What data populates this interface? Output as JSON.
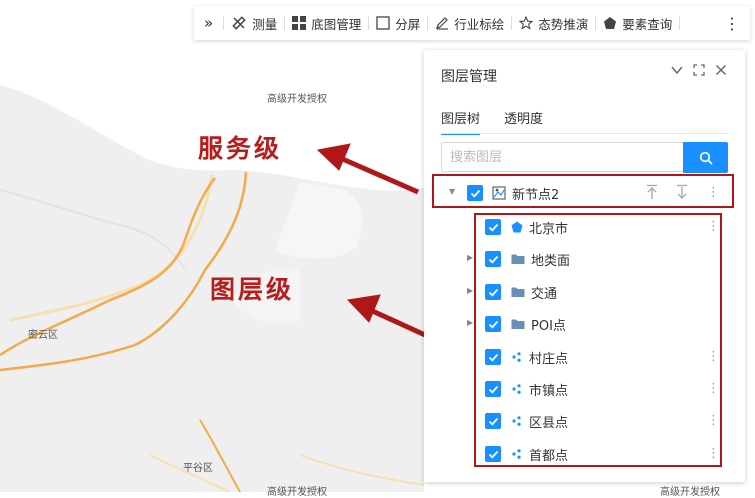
{
  "toolbar": {
    "items": [
      {
        "label": "测量",
        "icon": "ruler-icon"
      },
      {
        "label": "底图管理",
        "icon": "grid-icon"
      },
      {
        "label": "分屏",
        "icon": "split-screen-icon"
      },
      {
        "label": "行业标绘",
        "icon": "pen-icon"
      },
      {
        "label": "态势推演",
        "icon": "star-icon"
      },
      {
        "label": "要素查询",
        "icon": "pentagon-icon"
      }
    ]
  },
  "map": {
    "watermark": "高级开发授权",
    "district_mid": "密云区",
    "district_bottom": "平谷区"
  },
  "annotations": {
    "service_level": "服务级",
    "layer_level": "图层级"
  },
  "panel": {
    "title": "图层管理",
    "tabs": [
      {
        "label": "图层树",
        "active": true
      },
      {
        "label": "透明度",
        "active": false
      }
    ],
    "search_placeholder": "搜索图层",
    "root_node": {
      "label": "新节点2",
      "checked": true
    },
    "layers": [
      {
        "label": "北京市",
        "icon": "polygon-layer-icon",
        "expandable": false,
        "menu": true,
        "checked": true
      },
      {
        "label": "地类面",
        "icon": "folder-icon",
        "expandable": true,
        "menu": false,
        "checked": true
      },
      {
        "label": "交通",
        "icon": "folder-icon",
        "expandable": true,
        "menu": false,
        "checked": true
      },
      {
        "label": "POI点",
        "icon": "folder-icon",
        "expandable": true,
        "menu": false,
        "checked": true
      },
      {
        "label": "村庄点",
        "icon": "point-layer-icon",
        "expandable": false,
        "menu": true,
        "checked": true
      },
      {
        "label": "市镇点",
        "icon": "point-layer-icon",
        "expandable": false,
        "menu": true,
        "checked": true
      },
      {
        "label": "区县点",
        "icon": "point-layer-icon",
        "expandable": false,
        "menu": true,
        "checked": true
      },
      {
        "label": "首都点",
        "icon": "point-layer-icon",
        "expandable": false,
        "menu": true,
        "checked": true
      }
    ]
  },
  "colors": {
    "accent": "#1890ff",
    "annotation": "#b81c1c",
    "land": "#f0f0f0",
    "road": "#f5a94a"
  }
}
